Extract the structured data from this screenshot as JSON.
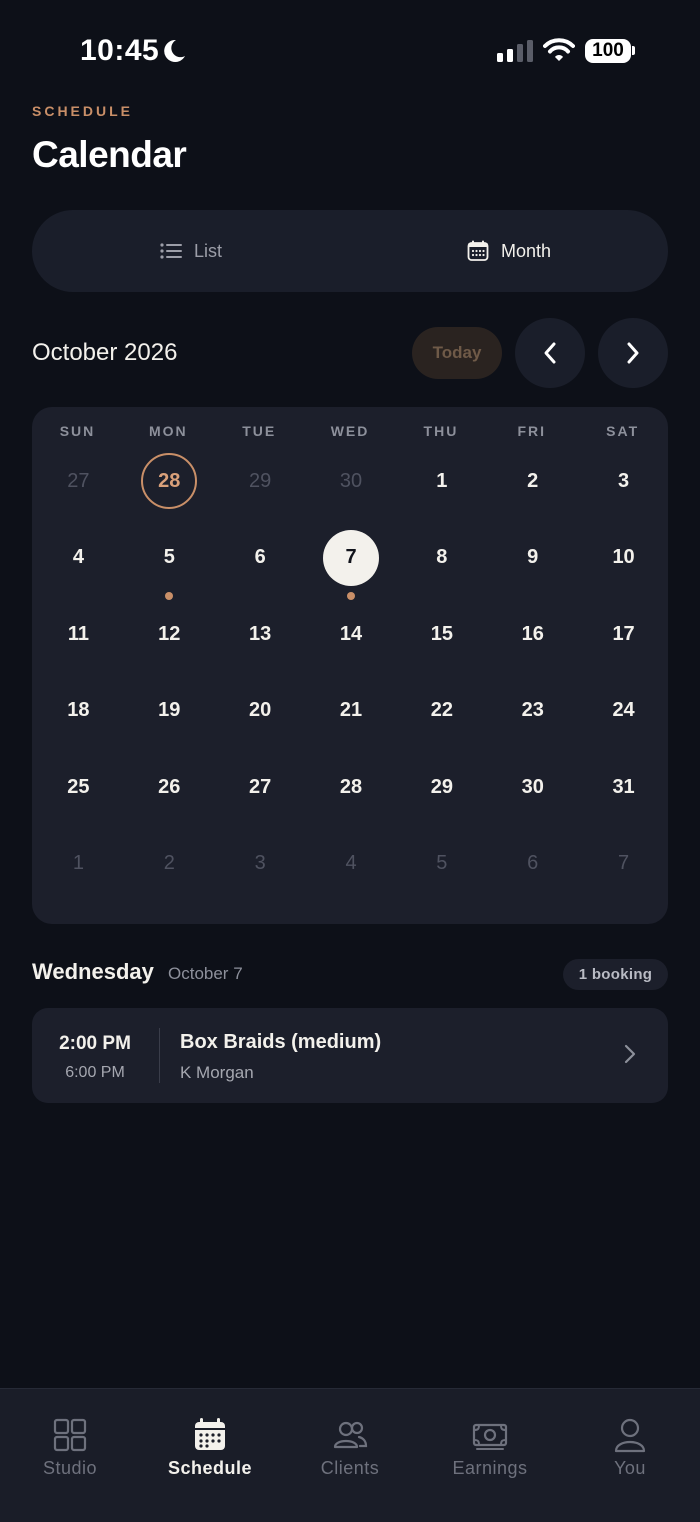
{
  "status": {
    "time": "10:45",
    "battery": "100"
  },
  "header": {
    "eyebrow": "SCHEDULE",
    "title": "Calendar"
  },
  "view_toggle": {
    "list_label": "List",
    "month_label": "Month",
    "selected": "Month"
  },
  "calendar": {
    "month_label": "October 2026",
    "today_label": "Today",
    "weekdays": [
      "SUN",
      "MON",
      "TUE",
      "WED",
      "THU",
      "FRI",
      "SAT"
    ],
    "weeks": [
      [
        {
          "d": "27",
          "other": true
        },
        {
          "d": "28",
          "other": false,
          "today": true
        },
        {
          "d": "29",
          "other": true
        },
        {
          "d": "30",
          "other": true
        },
        {
          "d": "1"
        },
        {
          "d": "2"
        },
        {
          "d": "3"
        }
      ],
      [
        {
          "d": "4"
        },
        {
          "d": "5",
          "dot": true
        },
        {
          "d": "6"
        },
        {
          "d": "7",
          "selected": true,
          "dot": true
        },
        {
          "d": "8"
        },
        {
          "d": "9"
        },
        {
          "d": "10"
        }
      ],
      [
        {
          "d": "11"
        },
        {
          "d": "12"
        },
        {
          "d": "13"
        },
        {
          "d": "14"
        },
        {
          "d": "15"
        },
        {
          "d": "16"
        },
        {
          "d": "17"
        }
      ],
      [
        {
          "d": "18"
        },
        {
          "d": "19"
        },
        {
          "d": "20"
        },
        {
          "d": "21"
        },
        {
          "d": "22"
        },
        {
          "d": "23"
        },
        {
          "d": "24"
        }
      ],
      [
        {
          "d": "25"
        },
        {
          "d": "26"
        },
        {
          "d": "27"
        },
        {
          "d": "28"
        },
        {
          "d": "29"
        },
        {
          "d": "30"
        },
        {
          "d": "31"
        }
      ],
      [
        {
          "d": "1",
          "other": true
        },
        {
          "d": "2",
          "other": true
        },
        {
          "d": "3",
          "other": true
        },
        {
          "d": "4",
          "other": true
        },
        {
          "d": "5",
          "other": true
        },
        {
          "d": "6",
          "other": true
        },
        {
          "d": "7",
          "other": true
        }
      ]
    ]
  },
  "agenda": {
    "weekday": "Wednesday",
    "date": "October 7",
    "count_label": "1 booking",
    "bookings": [
      {
        "start": "2:00 PM",
        "end": "6:00 PM",
        "service": "Box Braids (medium)",
        "client": "K Morgan"
      }
    ]
  },
  "tabbar": {
    "active": "Schedule",
    "tabs": [
      {
        "label": "Studio",
        "icon": "grid-icon"
      },
      {
        "label": "Schedule",
        "icon": "calendar-icon"
      },
      {
        "label": "Clients",
        "icon": "people-icon"
      },
      {
        "label": "Earnings",
        "icon": "cash-icon"
      },
      {
        "label": "You",
        "icon": "person-icon"
      }
    ]
  },
  "colors": {
    "background": "#0d1018",
    "card": "#1c1f2b",
    "accent": "#c98f68",
    "selected_fill": "#f3f1ec"
  }
}
